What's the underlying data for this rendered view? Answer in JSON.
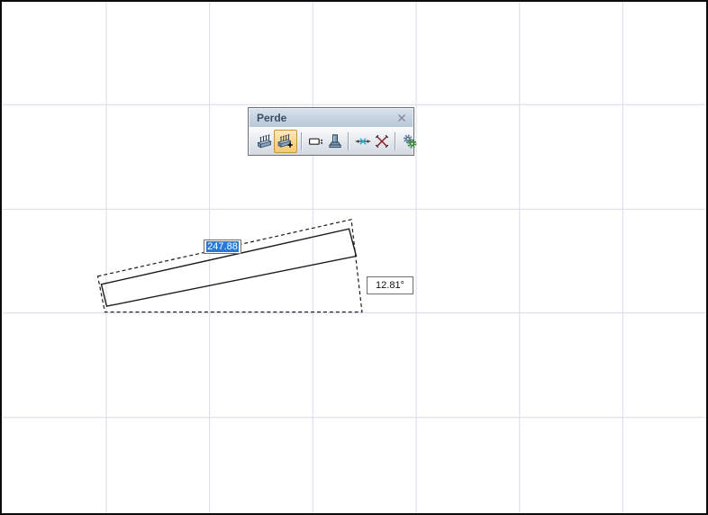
{
  "window": {
    "title": "Perde",
    "buttons": [
      {
        "id": "draw-wall",
        "icon": "wall-icon",
        "selected": false
      },
      {
        "id": "draw-wall-extended",
        "icon": "wall-add-icon",
        "selected": true
      },
      {
        "id": "wall-dimension",
        "icon": "rectangle-colon-icon",
        "selected": false
      },
      {
        "id": "polygon-wall-column",
        "icon": "column-icon",
        "selected": false
      },
      {
        "id": "axis-node",
        "icon": "axis-cross-icon",
        "selected": false
      },
      {
        "id": "axis-delete",
        "icon": "red-cross-icon",
        "selected": false
      },
      {
        "id": "settings",
        "icon": "gears-icon",
        "selected": false
      }
    ]
  },
  "drawing": {
    "length_value": "247.88",
    "angle_value": "12.81°"
  },
  "colors": {
    "selection_bg": "#2579d8",
    "selected_button_bg": "#fbd794",
    "selected_button_border": "#c6953e",
    "grid_line": "#d9dce7",
    "titlebar_text": "#3c5064",
    "wall_stroke": "#1a1a1a"
  }
}
